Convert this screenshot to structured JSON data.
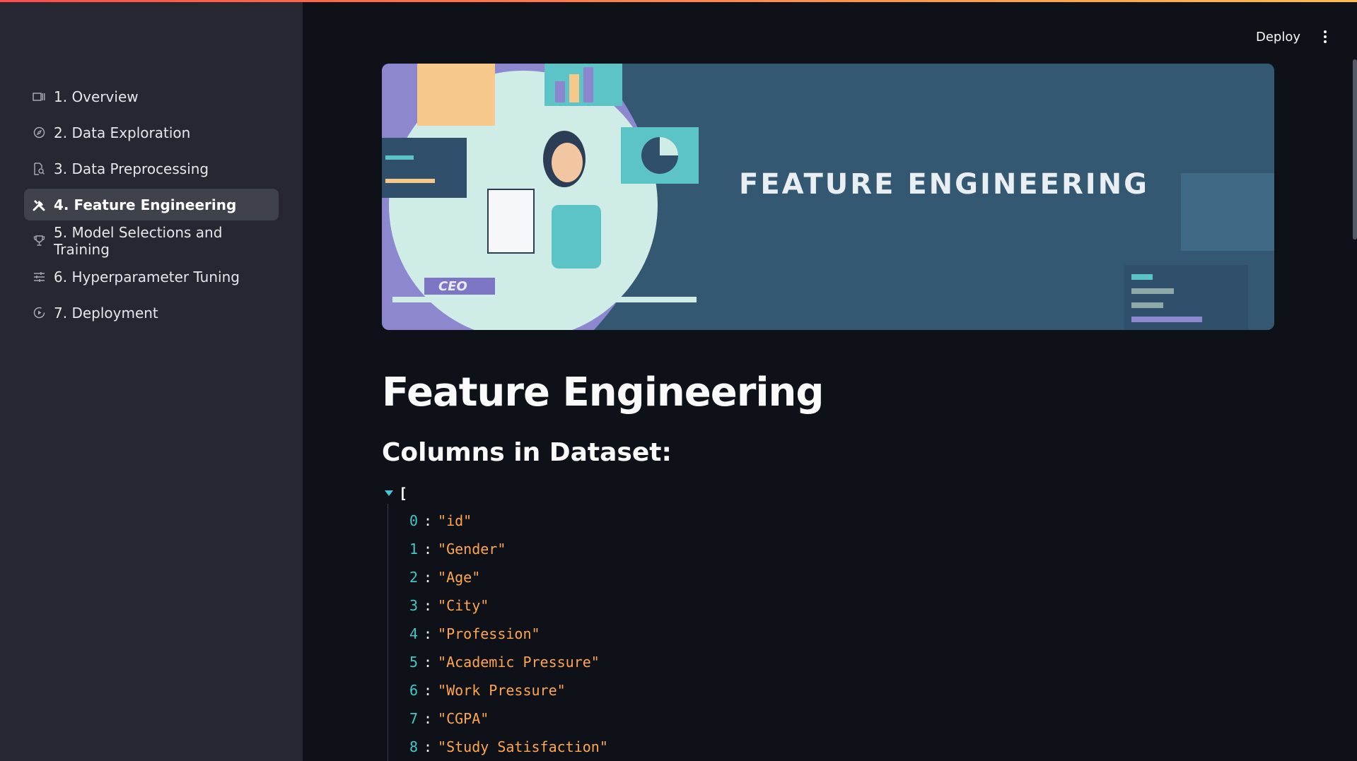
{
  "sidebar": {
    "items": [
      {
        "label": "1. Overview",
        "icon": "slideshow-icon",
        "active": false
      },
      {
        "label": "2. Data Exploration",
        "icon": "compass-icon",
        "active": false
      },
      {
        "label": "3. Data Preprocessing",
        "icon": "document-search-icon",
        "active": false
      },
      {
        "label": "4. Feature Engineering",
        "icon": "tools-icon",
        "active": true
      },
      {
        "label": "5. Model Selections and Training",
        "icon": "trophy-icon",
        "active": false
      },
      {
        "label": "6. Hyperparameter Tuning",
        "icon": "sliders-icon",
        "active": false
      },
      {
        "label": "7. Deployment",
        "icon": "play-circle-icon",
        "active": false
      }
    ]
  },
  "header": {
    "deploy_label": "Deploy",
    "menu_icon": "more-vertical-icon"
  },
  "banner": {
    "title": "FEATURE ENGINEERING",
    "badge": "CEO"
  },
  "main": {
    "title": "Feature Engineering",
    "subheading": "Columns in Dataset:",
    "json_open": "[",
    "columns": [
      {
        "index": "0",
        "value": "\"id\""
      },
      {
        "index": "1",
        "value": "\"Gender\""
      },
      {
        "index": "2",
        "value": "\"Age\""
      },
      {
        "index": "3",
        "value": "\"City\""
      },
      {
        "index": "4",
        "value": "\"Profession\""
      },
      {
        "index": "5",
        "value": "\"Academic Pressure\""
      },
      {
        "index": "6",
        "value": "\"Work Pressure\""
      },
      {
        "index": "7",
        "value": "\"CGPA\""
      },
      {
        "index": "8",
        "value": "\"Study Satisfaction\""
      }
    ]
  },
  "colors": {
    "background": "#0e1117",
    "sidebar": "#262730",
    "active_item": "#3f414b",
    "json_index": "#46c7c7",
    "json_string": "#ffa64d",
    "banner_bg": "#345872"
  }
}
